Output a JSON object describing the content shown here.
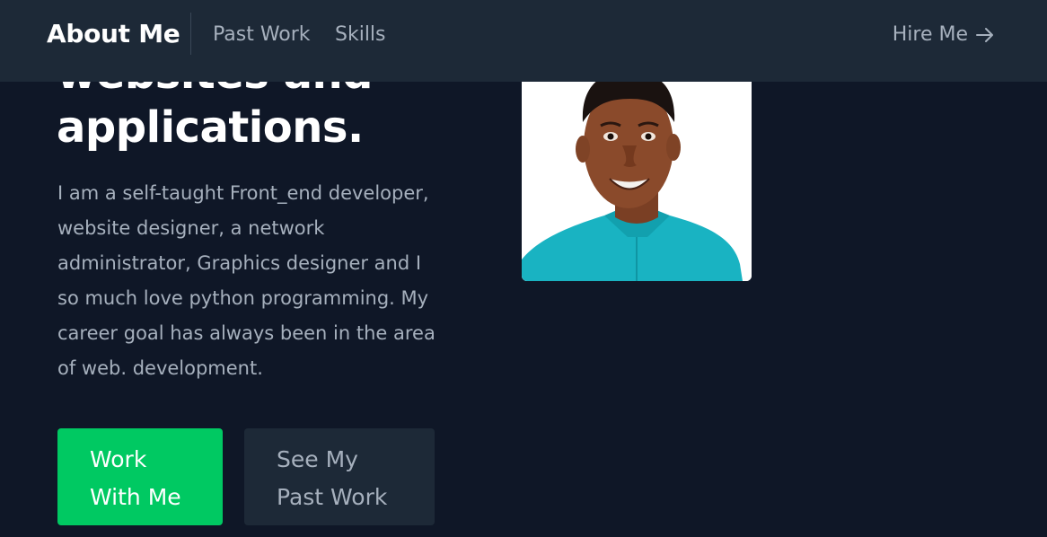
{
  "nav": {
    "brand": "About Me",
    "links": [
      "Past Work",
      "Skills"
    ],
    "hire": "Hire Me"
  },
  "hero": {
    "headline_lines": [
      "websites and",
      "applications."
    ],
    "bio": "I am a self-taught Front_end developer, website designer, a network administrator, Graphics designer and I so much love python programming. My career goal has always been in the area of web. development.",
    "primary_button_lines": [
      "Work",
      "With Me"
    ],
    "secondary_button_lines": [
      "See My",
      "Past Work"
    ]
  },
  "colors": {
    "background": "#0f1727",
    "navbar": "#1d2937",
    "accent_green": "#00c962",
    "muted_text": "#a6b0bd"
  },
  "icons": {
    "hire_arrow": "arrow-right-icon"
  }
}
